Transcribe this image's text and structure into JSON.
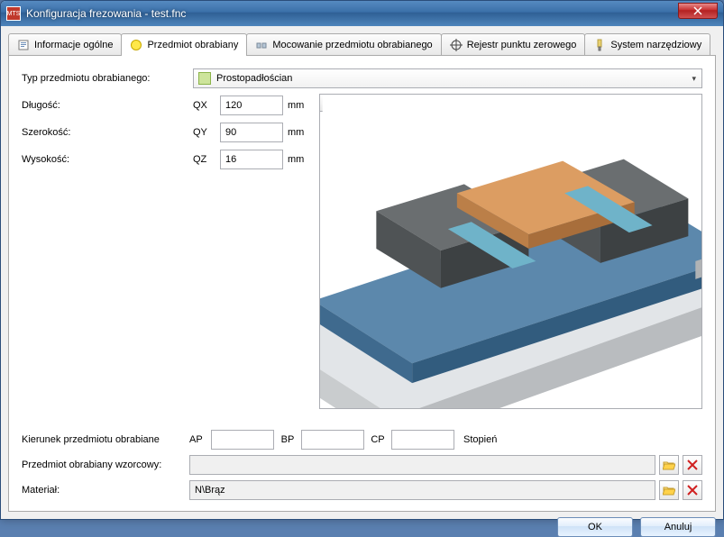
{
  "window": {
    "title": "Konfiguracja frezowania - test.fnc"
  },
  "tabs": {
    "info": "Informacje ogólne",
    "workpiece": "Przedmiot obrabiany",
    "clamping": "Mocowanie przedmiotu obrabianego",
    "zero": "Rejestr punktu zerowego",
    "tooling": "System narzędziowy"
  },
  "form": {
    "type_label": "Typ przedmiotu obrabianego:",
    "type_value": "Prostopadłościan",
    "length_label": "Długość:",
    "length_code": "QX",
    "length_value": "120",
    "width_label": "Szerokość:",
    "width_code": "QY",
    "width_value": "90",
    "height_label": "Wysokość:",
    "height_code": "QZ",
    "height_value": "16",
    "unit": "mm",
    "direction_label": "Kierunek przedmiotu obrabiane",
    "ap_label": "AP",
    "ap_value": "",
    "bp_label": "BP",
    "bp_value": "",
    "cp_label": "CP",
    "cp_value": "",
    "degree_label": "Stopień",
    "template_label": "Przedmiot obrabiany wzorcowy:",
    "template_value": "",
    "material_label": "Materiał:",
    "material_value": "N\\Brąz"
  },
  "buttons": {
    "ok": "OK",
    "cancel": "Anuluj"
  }
}
